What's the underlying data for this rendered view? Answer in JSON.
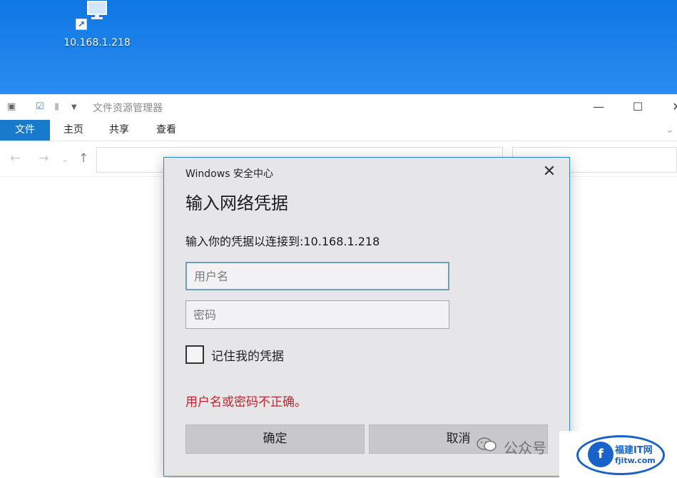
{
  "desktop": {
    "icon_label": "10.168.1.218"
  },
  "explorer": {
    "title": "文件资源管理器",
    "tabs": [
      "文件",
      "主页",
      "共享",
      "查看"
    ]
  },
  "dialog": {
    "caption": "Windows 安全中心",
    "heading": "输入网络凭据",
    "description": "输入你的凭据以连接到:10.168.1.218",
    "username_placeholder": "用户名",
    "password_placeholder": "密码",
    "remember_label": "记住我的凭据",
    "error_message": "用户名或密码不正确。",
    "ok_label": "确定",
    "cancel_label": "取消",
    "colors": {
      "error": "#c0262f",
      "accent": "#1979ca"
    }
  },
  "watermark": {
    "text": "公众号",
    "brand_cn": "福建IT网",
    "brand_en": "fjitw.com"
  }
}
